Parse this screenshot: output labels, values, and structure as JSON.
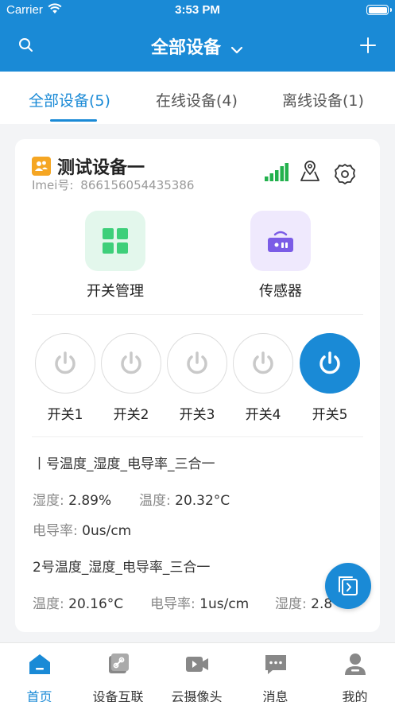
{
  "status_bar": {
    "carrier": "Carrier",
    "time": "3:53 PM"
  },
  "nav": {
    "title": "全部设备",
    "left_icon": "search-icon",
    "right_icon": "plus-icon"
  },
  "tabs": [
    {
      "label": "全部设备(5)",
      "active": true
    },
    {
      "label": "在线设备(4)",
      "active": false
    },
    {
      "label": "离线设备(1)",
      "active": false
    }
  ],
  "device": {
    "name": "测试设备一",
    "imei_label": "Imei号:",
    "imei": "866156054435386",
    "icons": [
      "signal-icon",
      "map-pin-icon",
      "gear-icon"
    ]
  },
  "functions": [
    {
      "label": "开关管理",
      "icon": "grid-icon"
    },
    {
      "label": "传感器",
      "icon": "sensor-icon"
    }
  ],
  "switches": [
    {
      "label": "开关1",
      "on": false
    },
    {
      "label": "开关2",
      "on": false
    },
    {
      "label": "开关3",
      "on": false
    },
    {
      "label": "开关4",
      "on": false
    },
    {
      "label": "开关5",
      "on": true
    }
  ],
  "sensors": [
    {
      "title": "丨号温度_湿度_电导率_三合一",
      "readings": [
        {
          "label": "湿度:",
          "value": "2.89%"
        },
        {
          "label": "温度:",
          "value": "20.32°C"
        },
        {
          "label": "电导率:",
          "value": "0us/cm"
        }
      ]
    },
    {
      "title": "2号温度_湿度_电导率_三合一",
      "readings": [
        {
          "label": "温度:",
          "value": "20.16°C"
        },
        {
          "label": "电导率:",
          "value": "1us/cm"
        },
        {
          "label": "湿度:",
          "value": "2.8"
        }
      ]
    }
  ],
  "tabbar": [
    {
      "label": "首页",
      "icon": "home-icon",
      "active": true
    },
    {
      "label": "设备互联",
      "icon": "link-icon",
      "active": false
    },
    {
      "label": "云摄像头",
      "icon": "camera-icon",
      "active": false
    },
    {
      "label": "消息",
      "icon": "message-icon",
      "active": false
    },
    {
      "label": "我的",
      "icon": "user-icon",
      "active": false
    }
  ],
  "colors": {
    "primary": "#1a8ad6",
    "signal": "#22b14c",
    "grid_green": "#3ecf7a",
    "sensor_purple": "#7b5ce6"
  }
}
